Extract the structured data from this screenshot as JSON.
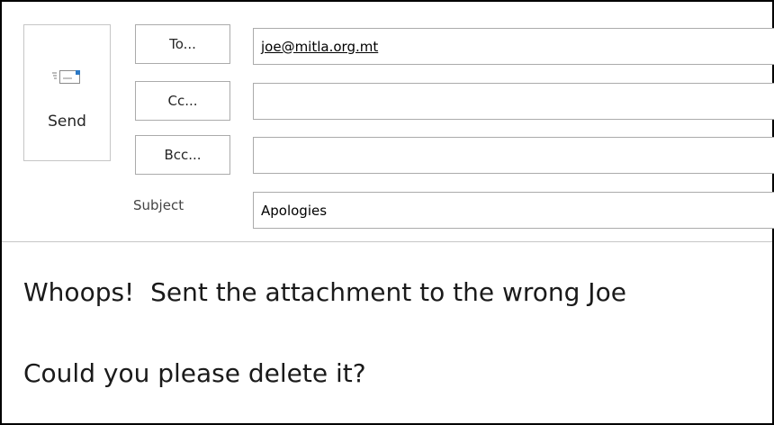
{
  "compose": {
    "send_label": "Send",
    "to_button": "To...",
    "cc_button": "Cc...",
    "bcc_button": "Bcc...",
    "to_value": "joe@mitla.org.mt",
    "cc_value": "",
    "bcc_value": "",
    "subject_label": "Subject",
    "subject_value": "Apologies"
  },
  "message": {
    "line1": "Whoops!  Sent the attachment to the wrong Joe",
    "line2": "Could you please delete it?"
  },
  "icons": {
    "send": "send-mail-icon"
  }
}
